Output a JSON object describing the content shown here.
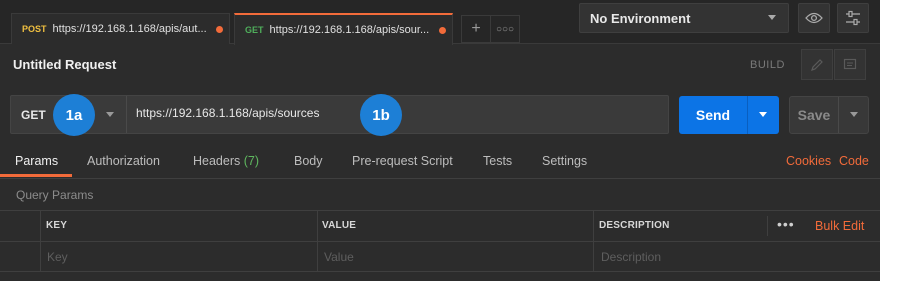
{
  "tabs": [
    {
      "method": "POST",
      "method_color": "#f0c040",
      "url": "https://192.168.1.168/apis/aut...",
      "unsaved": true
    },
    {
      "method": "GET",
      "method_color": "#4fae5b",
      "url": "https://192.168.1.168/apis/sour...",
      "unsaved": true,
      "active": true
    }
  ],
  "tab_actions": {
    "new_tab_icon": "plus-icon",
    "more_icon": "ellipsis-icon"
  },
  "environment": {
    "selected": "No Environment"
  },
  "request": {
    "title": "Untitled Request",
    "build_label": "BUILD"
  },
  "url_bar": {
    "method": "GET",
    "url": "https://192.168.1.168/apis/sources"
  },
  "annotations": {
    "method_badge": "1a",
    "url_badge": "1b"
  },
  "actions": {
    "send_label": "Send",
    "save_label": "Save"
  },
  "request_tabs": {
    "params": "Params",
    "authorization": "Authorization",
    "headers": "Headers",
    "headers_count": "(7)",
    "body": "Body",
    "prerequest": "Pre-request Script",
    "tests": "Tests",
    "settings": "Settings",
    "cookies": "Cookies",
    "code": "Code"
  },
  "query_params": {
    "section_title": "Query Params",
    "columns": {
      "key": "KEY",
      "value": "VALUE",
      "description": "DESCRIPTION"
    },
    "placeholders": {
      "key": "Key",
      "value": "Value",
      "description": "Description"
    },
    "more": "•••",
    "bulk_edit": "Bulk Edit"
  },
  "colors": {
    "accent": "#f26b3a",
    "send_blue": "#0c74e6",
    "badge_blue": "#1d7fd6",
    "background": "#2c2c2c"
  }
}
